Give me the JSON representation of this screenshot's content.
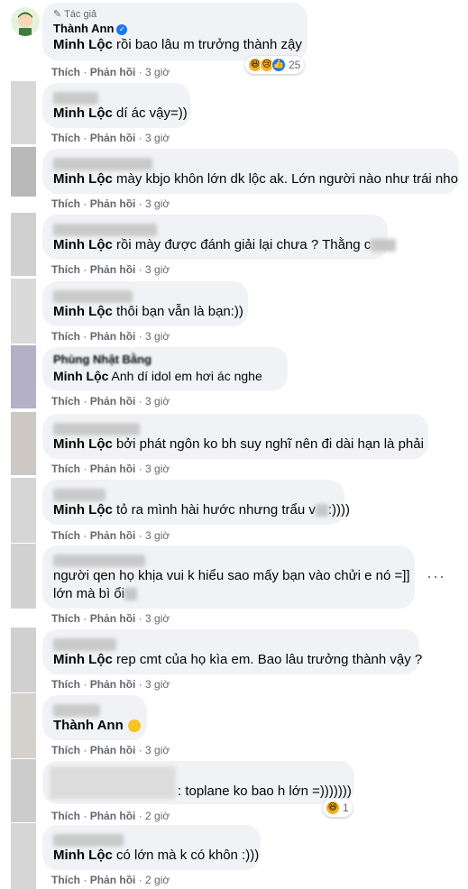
{
  "top_comment": {
    "badge": "Tác giả",
    "author": "Thành Ann",
    "mention": "Minh Lộc",
    "text": " rồi bao lâu m trưởng thành zậy",
    "reaction_count": "25",
    "like": "Thích",
    "reply": "Phản hồi",
    "time": "3 giờ"
  },
  "replies": [
    {
      "mention": "Minh Lộc",
      "text": " dí ác vậy=))",
      "time": "3 giờ"
    },
    {
      "mention": "Minh Lộc",
      "text": " mày kbjo khôn lớn dk lộc ak. Lớn người nào như trái nho",
      "time": "3 giờ"
    },
    {
      "mention": "Minh Lộc",
      "text": " rồi mày được đánh giải lại chưa ? Thằng c",
      "time": "3 giờ"
    },
    {
      "mention": "Minh Lộc",
      "text": " thôi bạn vẫn là bạn:))",
      "time": "3 giờ"
    },
    {
      "author": "Phùng Nhật Bằng",
      "mention": "Minh Lộc",
      "text": " Anh dí idol em hơi ác nghe",
      "time": "3 giờ"
    },
    {
      "mention": "Minh Lộc",
      "text": " bởi phát ngôn ko bh suy nghĩ nên đi dài hạn là phải",
      "time": "3 giờ"
    },
    {
      "mention": "Minh Lộc",
      "text": " tỏ ra mình hài hước nhưng trẩu v",
      "text_tail": ":))))",
      "time": "3 giờ"
    },
    {
      "text_line1": "người qen họ khịa vui k hiểu sao mấy bạn vào chửi e nó =]]",
      "text_line2": "lớn mà bì ổi",
      "time": "3 giờ"
    },
    {
      "mention": "Minh Lộc",
      "text": " rep cmt của họ kìa em. Bao lâu trưởng thành vậy ?",
      "time": "3 giờ"
    },
    {
      "mention": "Thành Ann",
      "text": "",
      "time": "3 giờ"
    },
    {
      "text_tail": ": toplane ko bao h lớn =)))))))",
      "reaction_count": "1",
      "time": "2 giờ"
    },
    {
      "mention": "Minh Lộc",
      "text": " có lớn mà k có khôn :)))",
      "time": "2 giờ"
    }
  ],
  "actions": {
    "like": "Thích",
    "reply": "Phản hồi",
    "sep": "·"
  },
  "more_label": "···",
  "colors": {
    "bubble": "#f0f2f5",
    "meta": "#65676b",
    "text": "#050505",
    "verified": "#1877f2"
  }
}
